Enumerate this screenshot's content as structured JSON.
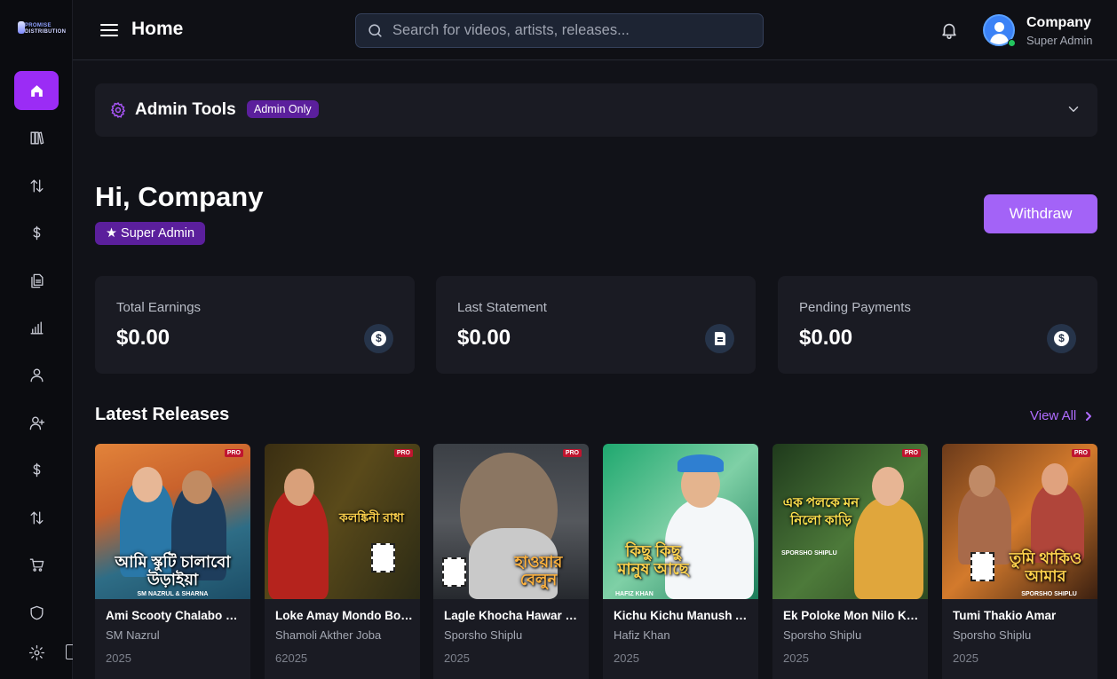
{
  "brand": {
    "line1": "PROMISE",
    "line2": "DISTRIBUTION"
  },
  "header": {
    "title": "Home",
    "search_placeholder": "Search for videos, artists, releases...",
    "user_name": "Company",
    "user_role": "Super Admin"
  },
  "sidebar": {
    "items": [
      {
        "icon": "home-icon",
        "active": true
      },
      {
        "icon": "library-icon"
      },
      {
        "icon": "transfer-icon"
      },
      {
        "icon": "dollar-icon"
      },
      {
        "icon": "documents-icon"
      },
      {
        "icon": "analytics-icon"
      },
      {
        "icon": "user-icon"
      },
      {
        "icon": "user-add-icon"
      },
      {
        "icon": "dollar-icon"
      },
      {
        "icon": "transfer-icon"
      },
      {
        "icon": "cart-icon"
      },
      {
        "icon": "shield-icon"
      },
      {
        "icon": "settings-icon"
      }
    ]
  },
  "admin_tools": {
    "title": "Admin Tools",
    "badge": "Admin Only"
  },
  "greeting": {
    "text": "Hi, Company",
    "badge": "★ Super Admin"
  },
  "withdraw_label": "Withdraw",
  "stats": [
    {
      "label": "Total Earnings",
      "value": "$0.00",
      "icon": "dollar-coin-icon"
    },
    {
      "label": "Last Statement",
      "value": "$0.00",
      "icon": "document-icon"
    },
    {
      "label": "Pending Payments",
      "value": "$0.00",
      "icon": "dollar-coin-icon"
    }
  ],
  "releases": {
    "title": "Latest Releases",
    "view_all": "View All",
    "items": [
      {
        "title": "Ami Scooty Chalabo U...",
        "artist": "SM Nazrul",
        "year": "2025",
        "cover_text": "আমি স্কুটি চালাবো উড়াইয়া",
        "cover_sub": "SM NAZRUL & SHARNA"
      },
      {
        "title": "Loke Amay Mondo Bol...",
        "artist": "Shamoli Akther Joba",
        "year": "62025",
        "cover_text": "কলঙ্কিনী রাধা",
        "cover_sub": ""
      },
      {
        "title": "Lagle Khocha Hawar B...",
        "artist": "Sporsho Shiplu",
        "year": "2025",
        "cover_text": "হাওয়ার বেলুন",
        "cover_sub": ""
      },
      {
        "title": "Kichu Kichu Manush A...",
        "artist": "Hafiz Khan",
        "year": "2025",
        "cover_text": "কিছু কিছু মানুষ আছে",
        "cover_sub": "HAFIZ KHAN"
      },
      {
        "title": "Ek Poloke Mon Nilo Kari",
        "artist": "Sporsho Shiplu",
        "year": "2025",
        "cover_text": "এক পলকে মন নিলো কাড়ি",
        "cover_sub": "SPORSHO SHIPLU"
      },
      {
        "title": "Tumi Thakio Amar",
        "artist": "Sporsho Shiplu",
        "year": "2025",
        "cover_text": "তুমি থাকিও আমার",
        "cover_sub": "SPORSHO SHIPLU"
      }
    ]
  },
  "colors": {
    "accent": "#9b2cf5",
    "badge": "#5b1f9c",
    "withdraw": "#a363f7",
    "link": "#b06cff"
  }
}
